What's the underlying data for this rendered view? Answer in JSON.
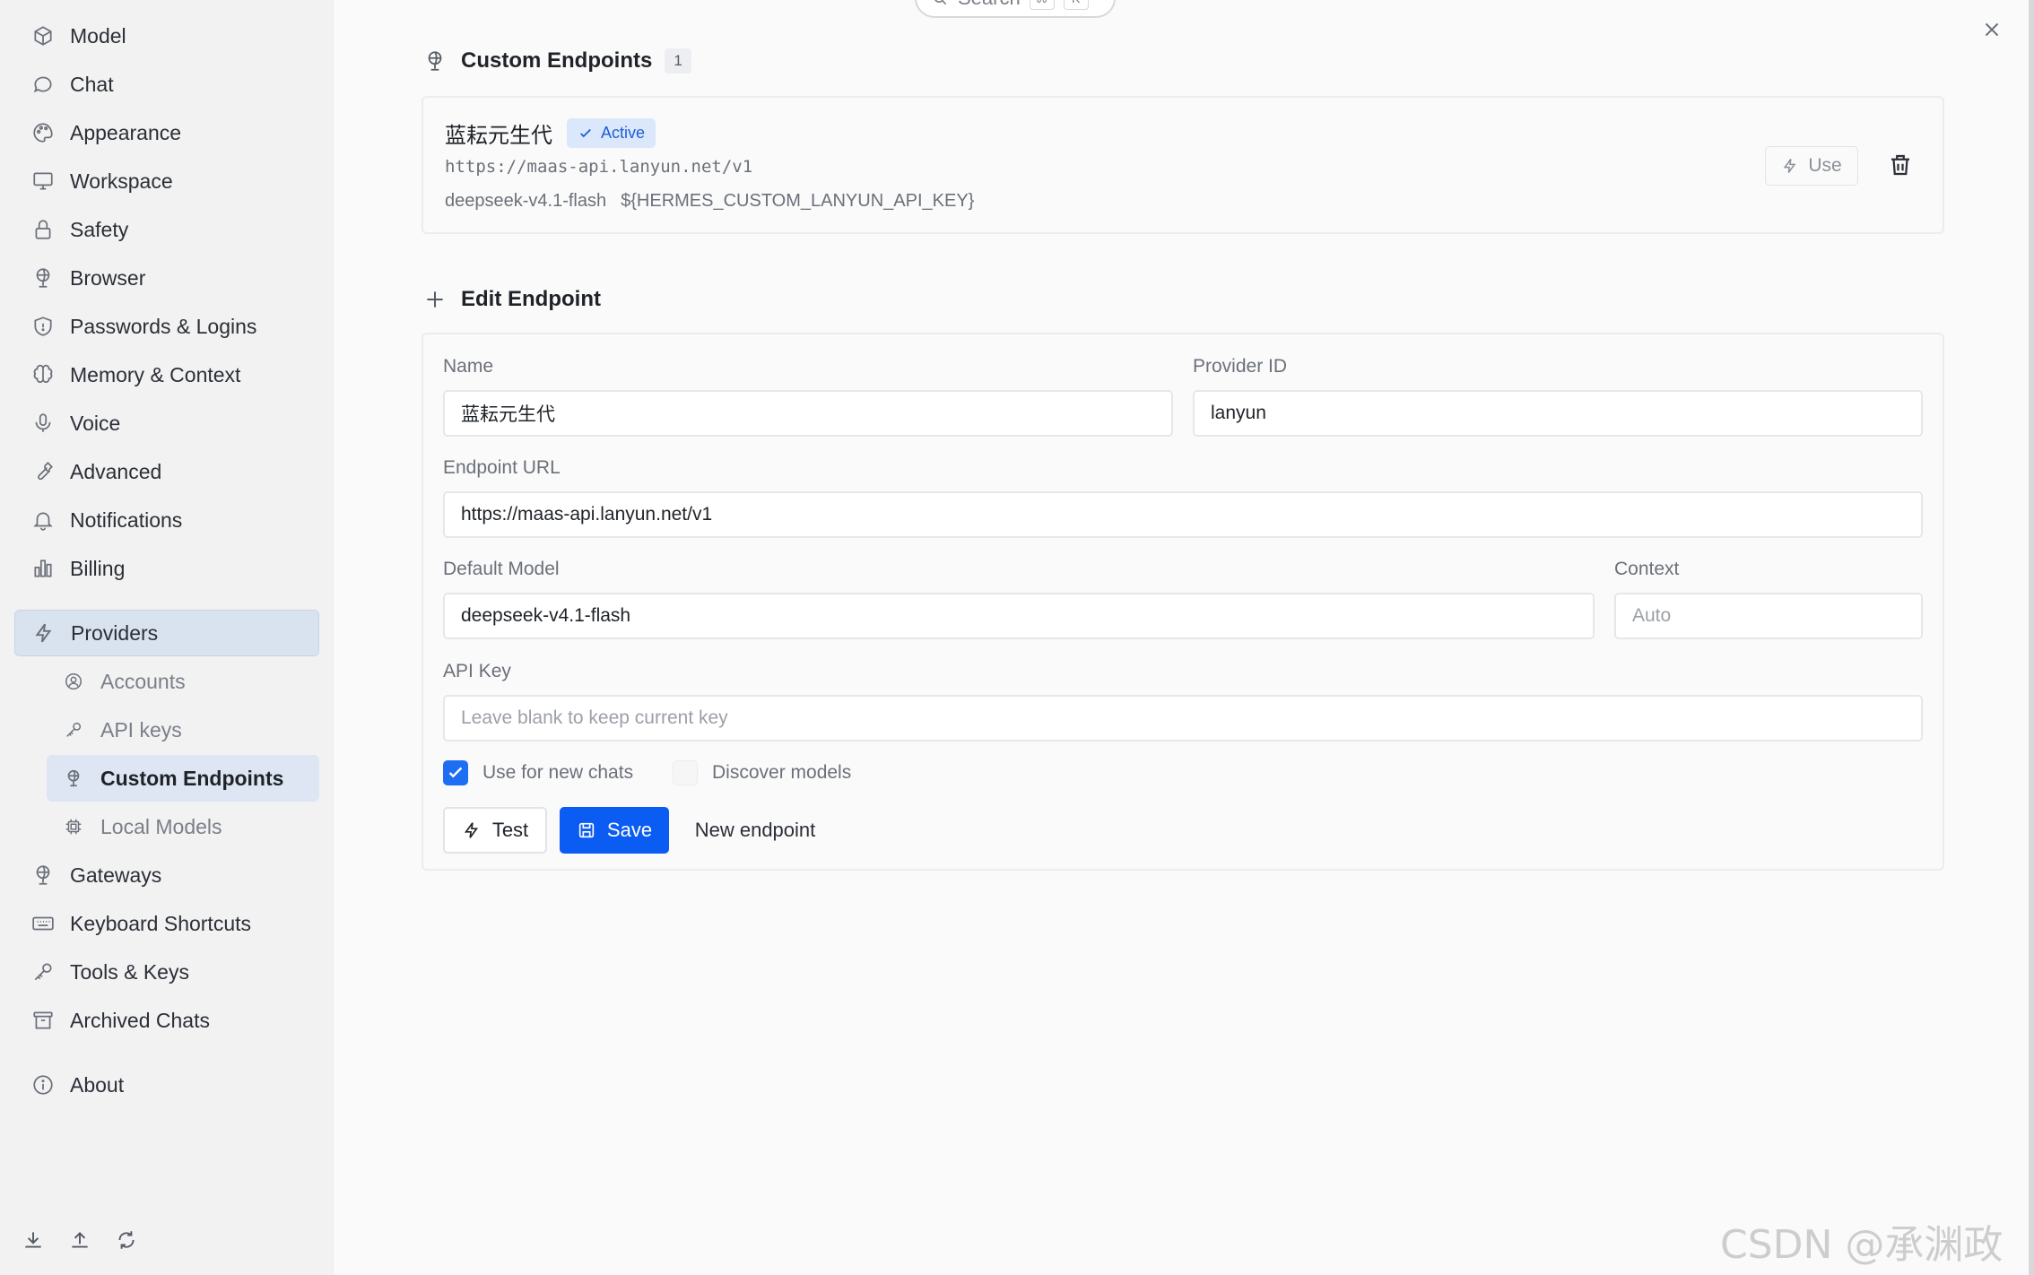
{
  "sidebar": {
    "items": [
      {
        "label": "Model",
        "icon": "cube-icon"
      },
      {
        "label": "Chat",
        "icon": "chat-bubble-icon"
      },
      {
        "label": "Appearance",
        "icon": "palette-icon"
      },
      {
        "label": "Workspace",
        "icon": "monitor-icon"
      },
      {
        "label": "Safety",
        "icon": "lock-icon"
      },
      {
        "label": "Browser",
        "icon": "globe-stand-icon"
      },
      {
        "label": "Passwords & Logins",
        "icon": "shield-icon"
      },
      {
        "label": "Memory & Context",
        "icon": "brain-icon"
      },
      {
        "label": "Voice",
        "icon": "microphone-icon"
      },
      {
        "label": "Advanced",
        "icon": "wrench-icon"
      },
      {
        "label": "Notifications",
        "icon": "bell-icon"
      },
      {
        "label": "Billing",
        "icon": "bar-chart-icon"
      }
    ],
    "providers": {
      "label": "Providers",
      "icon": "lightning-icon",
      "subitems": [
        {
          "label": "Accounts",
          "icon": "user-circle-icon"
        },
        {
          "label": "API keys",
          "icon": "key-icon"
        },
        {
          "label": "Custom Endpoints",
          "icon": "globe-stand-icon",
          "active": true
        },
        {
          "label": "Local Models",
          "icon": "chip-icon"
        }
      ]
    },
    "items_after": [
      {
        "label": "Gateways",
        "icon": "globe-stand-icon"
      },
      {
        "label": "Keyboard Shortcuts",
        "icon": "keyboard-icon"
      },
      {
        "label": "Tools & Keys",
        "icon": "key-icon"
      },
      {
        "label": "Archived Chats",
        "icon": "archive-icon"
      }
    ],
    "about": {
      "label": "About",
      "icon": "info-icon"
    },
    "footer_icons": [
      "download-icon",
      "upload-icon",
      "refresh-icon"
    ]
  },
  "search": {
    "label": "Search",
    "kbd1": "⌘",
    "kbd2": "K"
  },
  "custom_endpoints": {
    "title": "Custom Endpoints",
    "count": "1",
    "endpoint": {
      "name": "蓝耘元生代",
      "status": "Active",
      "url": "https://maas-api.lanyun.net/v1",
      "model": "deepseek-v4.1-flash",
      "api_key_var": "${HERMES_CUSTOM_LANYUN_API_KEY}",
      "use_label": "Use"
    }
  },
  "edit_endpoint": {
    "title": "Edit Endpoint",
    "name_label": "Name",
    "name_value": "蓝耘元生代",
    "provider_id_label": "Provider ID",
    "provider_id_value": "lanyun",
    "endpoint_url_label": "Endpoint URL",
    "endpoint_url_value": "https://maas-api.lanyun.net/v1",
    "default_model_label": "Default Model",
    "default_model_value": "deepseek-v4.1-flash",
    "context_label": "Context",
    "context_placeholder": "Auto",
    "api_key_label": "API Key",
    "api_key_placeholder": "Leave blank to keep current key",
    "use_for_new_chats_label": "Use for new chats",
    "use_for_new_chats_checked": true,
    "discover_models_label": "Discover models",
    "discover_models_checked": false,
    "test_label": "Test",
    "save_label": "Save",
    "new_endpoint_label": "New endpoint"
  },
  "watermark": "CSDN @承渊政道",
  "colors": {
    "accent": "#0b5cf2",
    "active_badge_bg": "#dbe7fb",
    "sidebar_active": "#d9e3f0"
  }
}
